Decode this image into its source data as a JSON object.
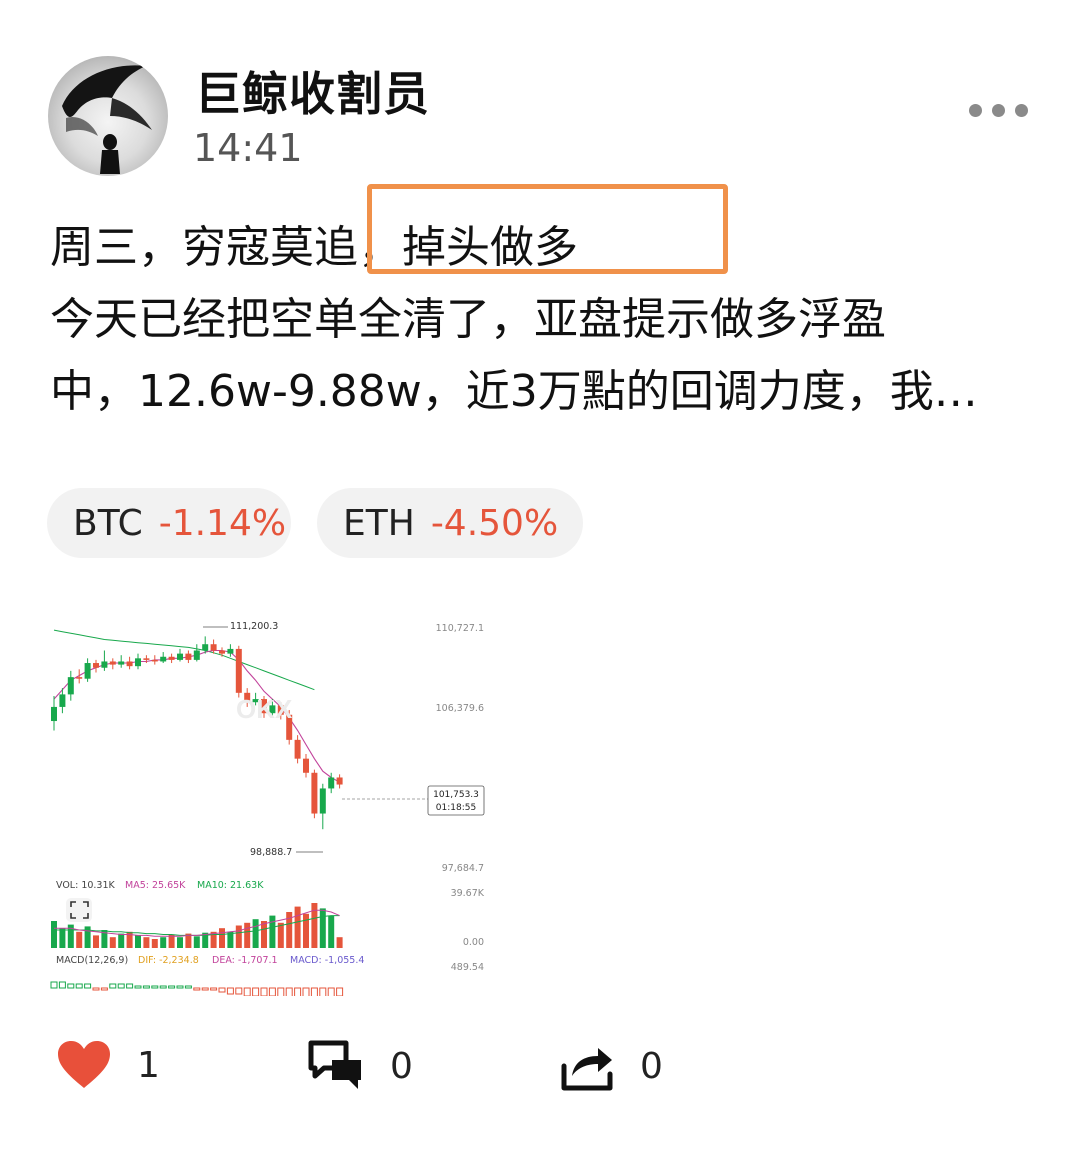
{
  "author": {
    "name": "巨鲸收割员",
    "time": "14:41"
  },
  "post": {
    "lines": [
      "周三，穷寇莫追，掉头做多",
      "今天已经把空单全清了，亚盘提示做多浮盈",
      "中，12.6w-9.88w，近3万點的回调力度，我…"
    ]
  },
  "tickers": [
    {
      "symbol": "BTC",
      "change": "-1.14%"
    },
    {
      "symbol": "ETH",
      "change": "-4.50%"
    }
  ],
  "colors": {
    "up": "#18a84c",
    "down": "#e5553b",
    "highlight": "#f0914a",
    "like": "#e8503a"
  },
  "chart_data": {
    "type": "candlestick",
    "price_labels": [
      "110,727.1",
      "106,379.6",
      "97,684.7"
    ],
    "high_label": "111,200.3",
    "low_label": "98,888.7",
    "current_price": "101,753.3",
    "countdown": "01:18:55",
    "volume": {
      "label": "VOL: 10.31K",
      "ma5": "MA5: 25.65K",
      "ma10": "MA10: 21.63K",
      "axis_top": "39.67K",
      "axis_zero": "0.00"
    },
    "macd": {
      "label": "MACD(12,26,9)",
      "dif": "DIF: -2,234.8",
      "dea": "DEA: -1,707.1",
      "macd": "MACD: -1,055.4",
      "axis_top": "489.54"
    },
    "watermark": "OKX",
    "ylim": [
      97000,
      112500
    ],
    "candles": [
      [
        105800,
        106700,
        105200,
        107400
      ],
      [
        106700,
        107500,
        106300,
        107900
      ],
      [
        107500,
        108600,
        107100,
        109000
      ],
      [
        108600,
        108500,
        108200,
        109100
      ],
      [
        108500,
        109500,
        108300,
        109800
      ],
      [
        109500,
        109200,
        108900,
        109700
      ],
      [
        109200,
        109600,
        109000,
        110300
      ],
      [
        109600,
        109400,
        109100,
        109800
      ],
      [
        109400,
        109600,
        109200,
        110000
      ],
      [
        109600,
        109300,
        109100,
        109900
      ],
      [
        109300,
        109800,
        109100,
        110100
      ],
      [
        109800,
        109700,
        109500,
        110000
      ],
      [
        109700,
        109600,
        109400,
        110000
      ],
      [
        109600,
        109900,
        109500,
        110200
      ],
      [
        109900,
        109700,
        109500,
        110100
      ],
      [
        109700,
        110100,
        109600,
        110400
      ],
      [
        110100,
        109700,
        109500,
        110300
      ],
      [
        109700,
        110300,
        109600,
        110700
      ],
      [
        110300,
        110700,
        110100,
        111200
      ],
      [
        110700,
        110300,
        110100,
        111000
      ],
      [
        110300,
        110100,
        109900,
        110500
      ],
      [
        110100,
        110400,
        109900,
        110700
      ],
      [
        110400,
        107600,
        107300,
        110600
      ],
      [
        107600,
        107000,
        106700,
        107900
      ],
      [
        107000,
        107200,
        106800,
        107600
      ],
      [
        107200,
        106300,
        106000,
        107400
      ],
      [
        106300,
        106800,
        106100,
        107200
      ],
      [
        106800,
        106200,
        105900,
        107000
      ],
      [
        106200,
        104600,
        104300,
        106500
      ],
      [
        104600,
        103400,
        103100,
        104900
      ],
      [
        103400,
        102500,
        102200,
        103700
      ],
      [
        102500,
        99900,
        99600,
        102700
      ],
      [
        99900,
        101500,
        98900,
        101800
      ],
      [
        101500,
        102200,
        101200,
        102500
      ],
      [
        102200,
        101750,
        101500,
        102400
      ]
    ],
    "ma_fast": [
      107200,
      107800,
      108400,
      108700,
      109000,
      109200,
      109400,
      109500,
      109500,
      109500,
      109600,
      109600,
      109700,
      109700,
      109800,
      109800,
      109900,
      110000,
      110200,
      110300,
      110300,
      110200,
      109700,
      109000,
      108400,
      107700,
      107200,
      106700,
      106000,
      105200,
      104300,
      103400,
      102600,
      102200,
      101900
    ],
    "ma_slow": [
      111600,
      111500,
      111400,
      111300,
      111200,
      111100,
      111000,
      110950,
      110900,
      110850,
      110800,
      110750,
      110700,
      110650,
      110600,
      110550,
      110500,
      110400,
      110300,
      110150,
      110000,
      109800,
      109600,
      109400,
      109200,
      109000,
      108800,
      108600,
      108400,
      108200,
      108000,
      107800
    ],
    "volumes": [
      30,
      22,
      26,
      18,
      24,
      14,
      20,
      12,
      16,
      18,
      14,
      12,
      10,
      12,
      15,
      12,
      16,
      13,
      17,
      18,
      22,
      18,
      25,
      28,
      32,
      30,
      36,
      28,
      40,
      46,
      38,
      50,
      44,
      36,
      12
    ],
    "vol_ma5": [
      22,
      22,
      22,
      20,
      19,
      18,
      17,
      16,
      15,
      15,
      14,
      14,
      13,
      13,
      13,
      13,
      14,
      14,
      15,
      16,
      17,
      18,
      19,
      22,
      24,
      27,
      29,
      31,
      33,
      36,
      39,
      42,
      42,
      40,
      36
    ],
    "vol_ma10": [
      20,
      20,
      20,
      20,
      20,
      19,
      19,
      18,
      18,
      17,
      17,
      16,
      16,
      15,
      15,
      14,
      14,
      14,
      14,
      15,
      15,
      16,
      17,
      18,
      19,
      21,
      23,
      25,
      27,
      29,
      31,
      33,
      35,
      36,
      36
    ],
    "macd_hist": [
      3,
      3,
      2,
      2,
      2,
      -1,
      -1,
      2,
      2,
      2,
      1,
      1,
      1,
      1,
      1,
      1,
      1,
      -1,
      -1,
      -1,
      -2,
      -3,
      -3,
      -4,
      -4,
      -4,
      -4,
      -5,
      -5,
      -5,
      -5,
      -5,
      -5,
      -5,
      -4
    ]
  }
}
